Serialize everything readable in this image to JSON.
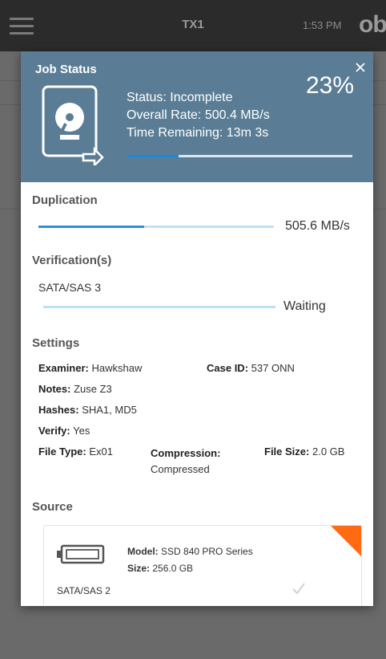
{
  "appbar": {
    "title": "TX1",
    "time": "1:53 PM",
    "brand": "ob"
  },
  "job_status": {
    "title": "Job Status",
    "status": "Status: Incomplete",
    "overall_rate": "Overall Rate: 500.4 MB/s",
    "time_remaining": "Time Remaining: 13m 3s",
    "percent": "23%",
    "progress_fraction": 0.23
  },
  "duplication": {
    "title": "Duplication",
    "rate": "505.6 MB/s",
    "progress_fraction": 0.45
  },
  "verification": {
    "title": "Verification(s)",
    "device": "SATA/SAS 3",
    "status": "Waiting",
    "progress_fraction": 0.0
  },
  "settings": {
    "title": "Settings",
    "examiner_label": "Examiner:",
    "examiner": "Hawkshaw",
    "case_id_label": "Case ID:",
    "case_id": "537 ONN",
    "notes_label": "Notes:",
    "notes": "Zuse Z3",
    "hashes_label": "Hashes:",
    "hashes": "SHA1, MD5",
    "verify_label": "Verify:",
    "verify": "Yes",
    "file_type_label": "File Type:",
    "file_type": "Ex01",
    "compression_label": "Compression:",
    "compression": "Compressed",
    "file_size_label": "File Size:",
    "file_size": "2.0 GB"
  },
  "source": {
    "title": "Source",
    "model_label": "Model:",
    "model": "SSD 840 PRO Series",
    "size_label": "Size:",
    "size": "256.0 GB",
    "port": "SATA/SAS 2"
  },
  "colors": {
    "header": "#5a7d95",
    "progress": "#1e88d8",
    "corner": "#ff6a13"
  }
}
